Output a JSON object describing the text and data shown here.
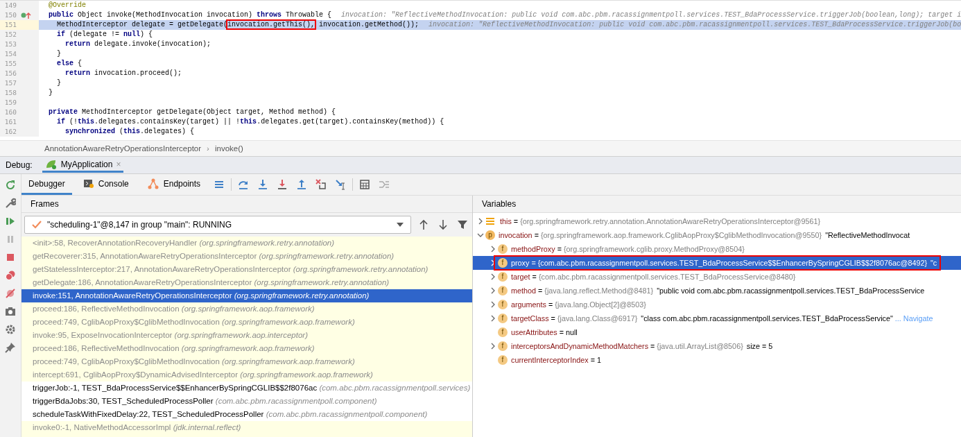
{
  "editor": {
    "lines": [
      {
        "number": "149",
        "kind": "annotation",
        "current": false,
        "code": "@Override"
      },
      {
        "number": "150",
        "kind": "code",
        "current": false,
        "marker": true,
        "code": "**public** Object invoke(MethodInvocation invocation) **throws** Throwable {",
        "hint": "invocation: \"ReflectiveMethodInvocation: public void com.abc.pbm.racassignmentpoll.services.TEST_BdaProcessService.triggerJob(boolean,long); target i"
      },
      {
        "number": "151",
        "kind": "code",
        "current": true,
        "code": "  MethodInterceptor delegate = getDelegate(",
        "boxed": "invocation.getThis(),",
        "code_after": " invocation.getMethod());",
        "hint": "invocation: \"ReflectiveMethodInvocation: public void com.abc.pbm.racassignmentpoll.services.TEST_BdaProcessService.triggerJob(bo"
      },
      {
        "number": "152",
        "kind": "code",
        "current": false,
        "code": "  **if** (delegate != **null**) {"
      },
      {
        "number": "153",
        "kind": "code",
        "current": false,
        "code": "    **return** delegate.invoke(invocation);"
      },
      {
        "number": "154",
        "kind": "code",
        "current": false,
        "code": "  }"
      },
      {
        "number": "155",
        "kind": "code",
        "current": false,
        "code": "  **else** {"
      },
      {
        "number": "156",
        "kind": "code",
        "current": false,
        "code": "    **return** invocation.proceed();"
      },
      {
        "number": "157",
        "kind": "code",
        "current": false,
        "code": "  }"
      },
      {
        "number": "158",
        "kind": "code",
        "current": false,
        "code": "}"
      },
      {
        "number": "159",
        "kind": "code",
        "current": false
      },
      {
        "number": "160",
        "kind": "code",
        "current": false,
        "code": "**private** MethodInterceptor getDelegate(Object target, Method method) {"
      },
      {
        "number": "161",
        "kind": "code",
        "current": false,
        "code": "  **if** (!**this**.delegates.containsKey(target) || !**this**.delegates.get(target).containsKey(method)) {"
      },
      {
        "number": "162",
        "kind": "code",
        "current": false,
        "code": "    **synchronized** (**this**.delegates) {"
      }
    ]
  },
  "breadcrumb": [
    "AnnotationAwareRetryOperationsInterceptor",
    "invoke()"
  ],
  "breadcrumb_separator": "›",
  "debug": {
    "label": "Debug:",
    "session_tab": {
      "label": "MyApplication",
      "close": "×"
    }
  },
  "debugger_tabs": [
    {
      "label": "Debugger",
      "selected": true
    },
    {
      "label": "Console",
      "selected": false
    },
    {
      "label": "Endpoints",
      "selected": false
    }
  ],
  "frames": {
    "title": "Frames",
    "thread": "\"scheduling-1\"@8,147 in group \"main\": RUNNING",
    "items": [
      {
        "method": "<init>:58, RecoverAnnotationRecoveryHandler",
        "package": "(org.springframework.retry.annotation)",
        "library": true,
        "selected": false
      },
      {
        "method": "getRecoverer:315, AnnotationAwareRetryOperationsInterceptor",
        "package": "(org.springframework.retry.annotation)",
        "library": true,
        "selected": false
      },
      {
        "method": "getStatelessInterceptor:217, AnnotationAwareRetryOperationsInterceptor",
        "package": "(org.springframework.retry.annotation)",
        "library": true,
        "selected": false
      },
      {
        "method": "getDelegate:186, AnnotationAwareRetryOperationsInterceptor",
        "package": "(org.springframework.retry.annotation)",
        "library": true,
        "selected": false
      },
      {
        "method": "invoke:151, AnnotationAwareRetryOperationsInterceptor",
        "package": "(org.springframework.retry.annotation)",
        "library": true,
        "selected": true
      },
      {
        "method": "proceed:186, ReflectiveMethodInvocation",
        "package": "(org.springframework.aop.framework)",
        "library": true,
        "selected": false
      },
      {
        "method": "proceed:749, CglibAopProxy$CglibMethodInvocation",
        "package": "(org.springframework.aop.framework)",
        "library": true,
        "selected": false
      },
      {
        "method": "invoke:95, ExposeInvocationInterceptor",
        "package": "(org.springframework.aop.interceptor)",
        "library": true,
        "selected": false
      },
      {
        "method": "proceed:186, ReflectiveMethodInvocation",
        "package": "(org.springframework.aop.framework)",
        "library": true,
        "selected": false
      },
      {
        "method": "proceed:749, CglibAopProxy$CglibMethodInvocation",
        "package": "(org.springframework.aop.framework)",
        "library": true,
        "selected": false
      },
      {
        "method": "intercept:691, CglibAopProxy$DynamicAdvisedInterceptor",
        "package": "(org.springframework.aop.framework)",
        "library": true,
        "selected": false
      },
      {
        "method": "triggerJob:-1, TEST_BdaProcessService$$EnhancerBySpringCGLIB$$2f8076ac",
        "package": "(com.abc.pbm.racassignmentpoll.services)",
        "library": false,
        "selected": false
      },
      {
        "method": "triggerBdaJobs:30, TEST_ScheduledProcessPoller",
        "package": "(com.abc.pbm.racassignmentpoll.component)",
        "library": false,
        "selected": false
      },
      {
        "method": "scheduleTaskWithFixedDelay:22, TEST_ScheduledProcessPoller",
        "package": "(com.abc.pbm.racassignmentpoll.component)",
        "library": false,
        "selected": false
      },
      {
        "method": "invoke0:-1, NativeMethodAccessorImpl",
        "package": "(jdk.internal.reflect)",
        "library": true,
        "selected": false
      }
    ]
  },
  "variables": {
    "title": "Variables",
    "items": [
      {
        "kind": "this",
        "name": "this",
        "eq": "=",
        "value": "{org.springframework.retry.annotation.AnnotationAwareRetryOperationsInterceptor@9561}",
        "expandable": true,
        "expanded": false,
        "selected": false
      },
      {
        "kind": "param",
        "badge": "p",
        "name": "invocation",
        "eq": "=",
        "value": "{org.springframework.aop.framework.CglibAopProxy$CglibMethodInvocation@9550}",
        "detail": "\"ReflectiveMethodInvocat",
        "expandable": true,
        "expanded": true,
        "selected": false,
        "children": [
          {
            "kind": "field",
            "badge": "f",
            "name": "methodProxy",
            "eq": "=",
            "value": "{org.springframework.cglib.proxy.MethodProxy@8504}",
            "expandable": true,
            "expanded": false,
            "selected": false
          },
          {
            "kind": "field",
            "badge": "f",
            "name": "proxy",
            "eq": "=",
            "value": "{com.abc.pbm.racassignmentpoll.services.TEST_BdaProcessService$$EnhancerBySpringCGLIB$$2f8076ac@8492}",
            "detail": "\"c",
            "expandable": true,
            "expanded": false,
            "selected": true,
            "boxed": true
          },
          {
            "kind": "field",
            "badge": "f",
            "name": "target",
            "eq": "=",
            "value": "{com.abc.pbm.racassignmentpoll.services.TEST_BdaProcessService@8480}",
            "expandable": true,
            "expanded": false,
            "selected": false
          },
          {
            "kind": "field",
            "badge": "f",
            "name": "method",
            "eq": "=",
            "value": "{java.lang.reflect.Method@8481}",
            "detail": "\"public void com.abc.pbm.racassignmentpoll.services.TEST_BdaProcessService",
            "expandable": true,
            "expanded": false,
            "selected": false
          },
          {
            "kind": "field",
            "badge": "f",
            "name": "arguments",
            "eq": "=",
            "value": "{java.lang.Object[2]@8503}",
            "expandable": true,
            "expanded": false,
            "selected": false
          },
          {
            "kind": "field",
            "badge": "f",
            "name": "targetClass",
            "eq": "=",
            "value": "{java.lang.Class@6917}",
            "detail": "\"class com.abc.pbm.racassignmentpoll.services.TEST_BdaProcessService\"",
            "link": "... Navigate",
            "expandable": true,
            "expanded": false,
            "selected": false
          },
          {
            "kind": "field",
            "badge": "f",
            "name": "userAttributes",
            "eq": "=",
            "plain_value": "null",
            "expandable": false,
            "selected": false
          },
          {
            "kind": "field",
            "badge": "f",
            "name": "interceptorsAndDynamicMethodMatchers",
            "eq": "=",
            "value": "{java.util.ArrayList@8506}",
            "detail": "size = 5",
            "expandable": true,
            "expanded": false,
            "selected": false
          },
          {
            "kind": "field",
            "badge": "f",
            "name": "currentInterceptorIndex",
            "eq": "=",
            "plain_value": "1",
            "expandable": false,
            "selected": false
          }
        ]
      }
    ]
  }
}
